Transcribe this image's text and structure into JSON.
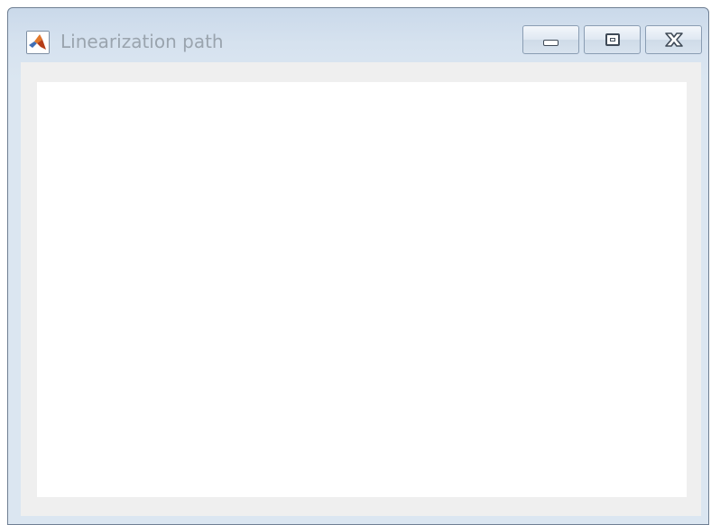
{
  "window": {
    "title": "Linearization path",
    "app_icon": "matlab-icon",
    "controls": {
      "minimize": "minimize-icon",
      "maximize": "maximize-icon",
      "close": "close-icon"
    }
  },
  "colors": {
    "titlebar": "#d6e2ef",
    "title_text": "#9aa4ae",
    "client_frame": "#efefef",
    "canvas": "#ffffff"
  }
}
